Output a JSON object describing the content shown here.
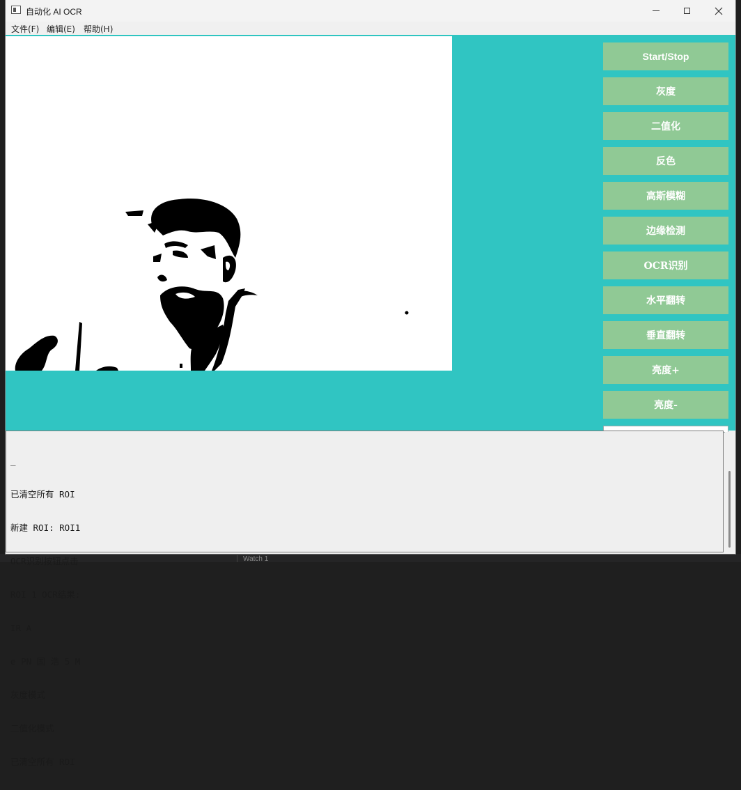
{
  "window": {
    "title": "自动化 AI OCR"
  },
  "menu": [
    {
      "label": "文件(F)"
    },
    {
      "label": "编辑(E)"
    },
    {
      "label": "帮助(H)"
    }
  ],
  "buttons": [
    {
      "label": "Start/Stop"
    },
    {
      "label": "灰度"
    },
    {
      "label": "二值化"
    },
    {
      "label": "反色"
    },
    {
      "label": "高斯模糊"
    },
    {
      "label": "边缘检测"
    },
    {
      "label": "OCR识别"
    },
    {
      "label": "水平翻转"
    },
    {
      "label": "垂直翻转"
    },
    {
      "label": "亮度+"
    },
    {
      "label": "亮度-"
    }
  ],
  "log": {
    "lines": [
      "_",
      "已清空所有 ROI",
      "新建 ROI: ROI1",
      "OCR识别按钮点击",
      "ROI 1 OCR结果:",
      "IR A",
      "e PN 国 浩 5 M",
      "灰度模式",
      "二值化模式",
      "已清空所有 ROI"
    ]
  },
  "background": {
    "bottom_panel_label": "Watch 1"
  },
  "colors": {
    "client_bg": "#30c5c2",
    "button_bg": "#90c995",
    "button_text": "#ffffff",
    "log_bg": "#efefef"
  },
  "video": {
    "mode": "binary black/white frame of a person"
  }
}
